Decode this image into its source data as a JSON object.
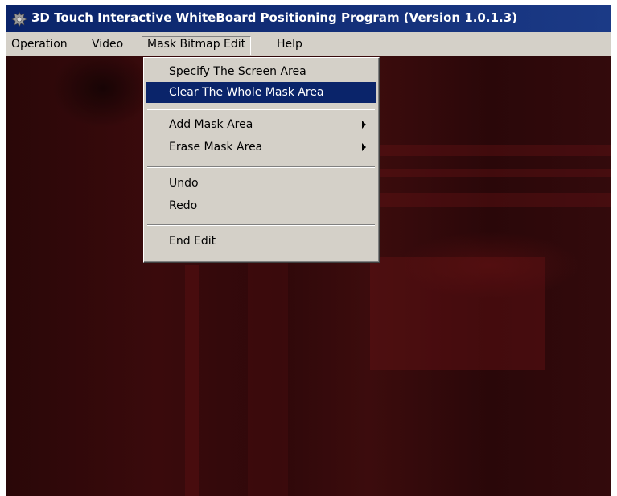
{
  "window": {
    "title": "3D Touch Interactive WhiteBoard Positioning Program (Version 1.0.1.3)",
    "icon": "app-gear-icon"
  },
  "menubar": {
    "items": [
      {
        "label": "Operation"
      },
      {
        "label": "Video"
      },
      {
        "label": "Mask Bitmap Edit"
      },
      {
        "label": "Help"
      }
    ]
  },
  "dropdown": {
    "items": [
      {
        "label": "Specify The Screen Area"
      },
      {
        "label": "Clear The Whole Mask Area"
      },
      {
        "label": "Add Mask Area"
      },
      {
        "label": "Erase Mask Area"
      },
      {
        "label": "Undo"
      },
      {
        "label": "Redo"
      },
      {
        "label": "End Edit"
      }
    ]
  },
  "colors": {
    "titlebar": "#0a246a",
    "menu_highlight": "#0a246a",
    "video_feed": "#330a0c"
  }
}
